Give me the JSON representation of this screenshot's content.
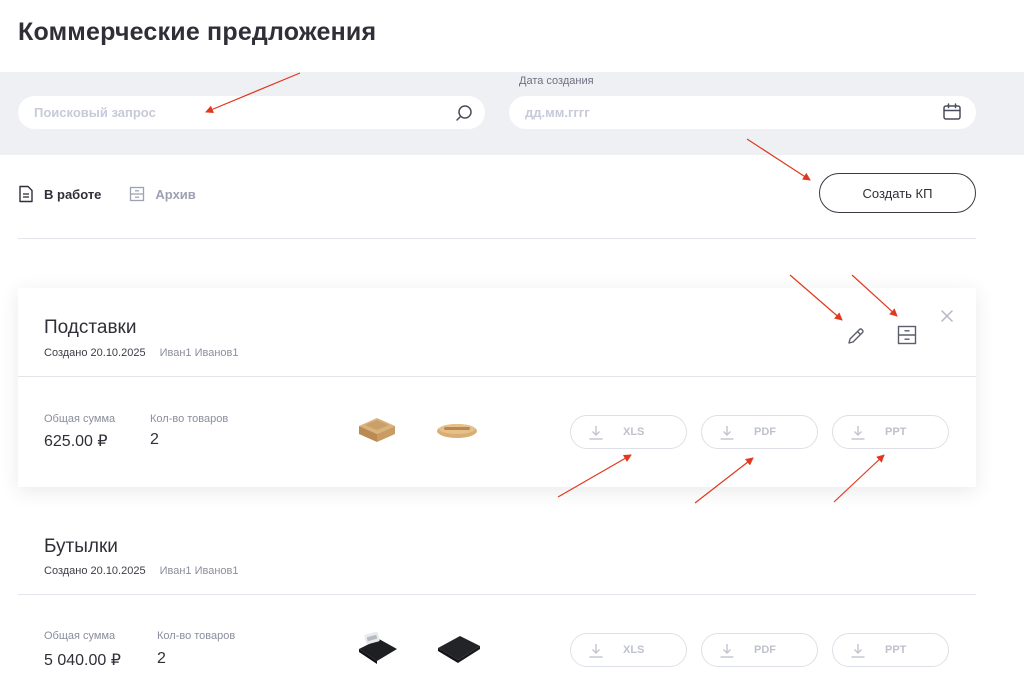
{
  "page": {
    "title": "Коммерческие предложения"
  },
  "filters": {
    "search_placeholder": "Поисковый запрос",
    "date_label": "Дата создания",
    "date_placeholder": "дд.мм.гггг"
  },
  "tabs": [
    {
      "label": "В работе",
      "active": true
    },
    {
      "label": "Архив",
      "active": false
    }
  ],
  "create_button": "Создать КП",
  "offers": [
    {
      "title": "Подставки",
      "created": "Создано 20.10.2025",
      "author": "Иван1 Иванов1",
      "total_label": "Общая сумма",
      "total_value": "625.00 ₽",
      "count_label": "Кол-во товаров",
      "count_value": "2",
      "downloads": [
        "XLS",
        "PDF",
        "PPT"
      ]
    },
    {
      "title": "Бутылки",
      "created": "Создано 20.10.2025",
      "author": "Иван1 Иванов1",
      "total_label": "Общая сумма",
      "total_value": "5 040.00 ₽",
      "count_label": "Кол-во товаров",
      "count_value": "2",
      "downloads": [
        "XLS",
        "PDF",
        "PPT"
      ]
    }
  ],
  "colors": {
    "annotation_arrow": "#e0391f",
    "filter_bar": "#eef0f4",
    "disabled": "#bfc2cc"
  },
  "icons": [
    "search-icon",
    "calendar-icon",
    "document-icon",
    "archive-icon",
    "pencil-icon",
    "archive-box-icon",
    "close-icon",
    "download-icon"
  ]
}
